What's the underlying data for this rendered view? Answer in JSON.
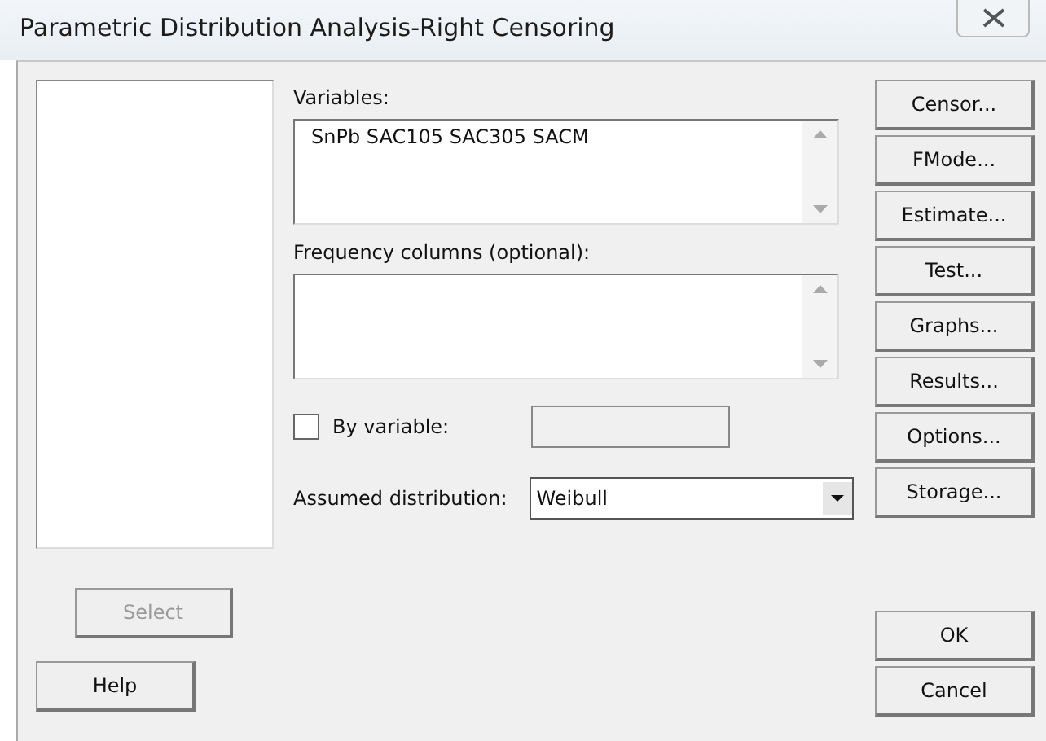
{
  "window": {
    "title": "Parametric Distribution Analysis-Right Censoring"
  },
  "variables": {
    "label": "Variables:",
    "value": "SnPb SAC105 SAC305 SACM"
  },
  "frequency": {
    "label": "Frequency columns (optional):"
  },
  "by_variable": {
    "label": "By variable:",
    "checked": false
  },
  "distribution": {
    "label": "Assumed distribution:",
    "value": "Weibull"
  },
  "side_buttons": [
    {
      "label": "Censor..."
    },
    {
      "label": "FMode..."
    },
    {
      "label": "Estimate..."
    },
    {
      "label": "Test..."
    },
    {
      "label": "Graphs..."
    },
    {
      "label": "Results..."
    },
    {
      "label": "Options..."
    },
    {
      "label": "Storage..."
    }
  ],
  "select_button": {
    "label": "Select",
    "disabled": true
  },
  "help_button": {
    "label": "Help"
  },
  "ok_button": {
    "label": "OK"
  },
  "cancel_button": {
    "label": "Cancel"
  }
}
